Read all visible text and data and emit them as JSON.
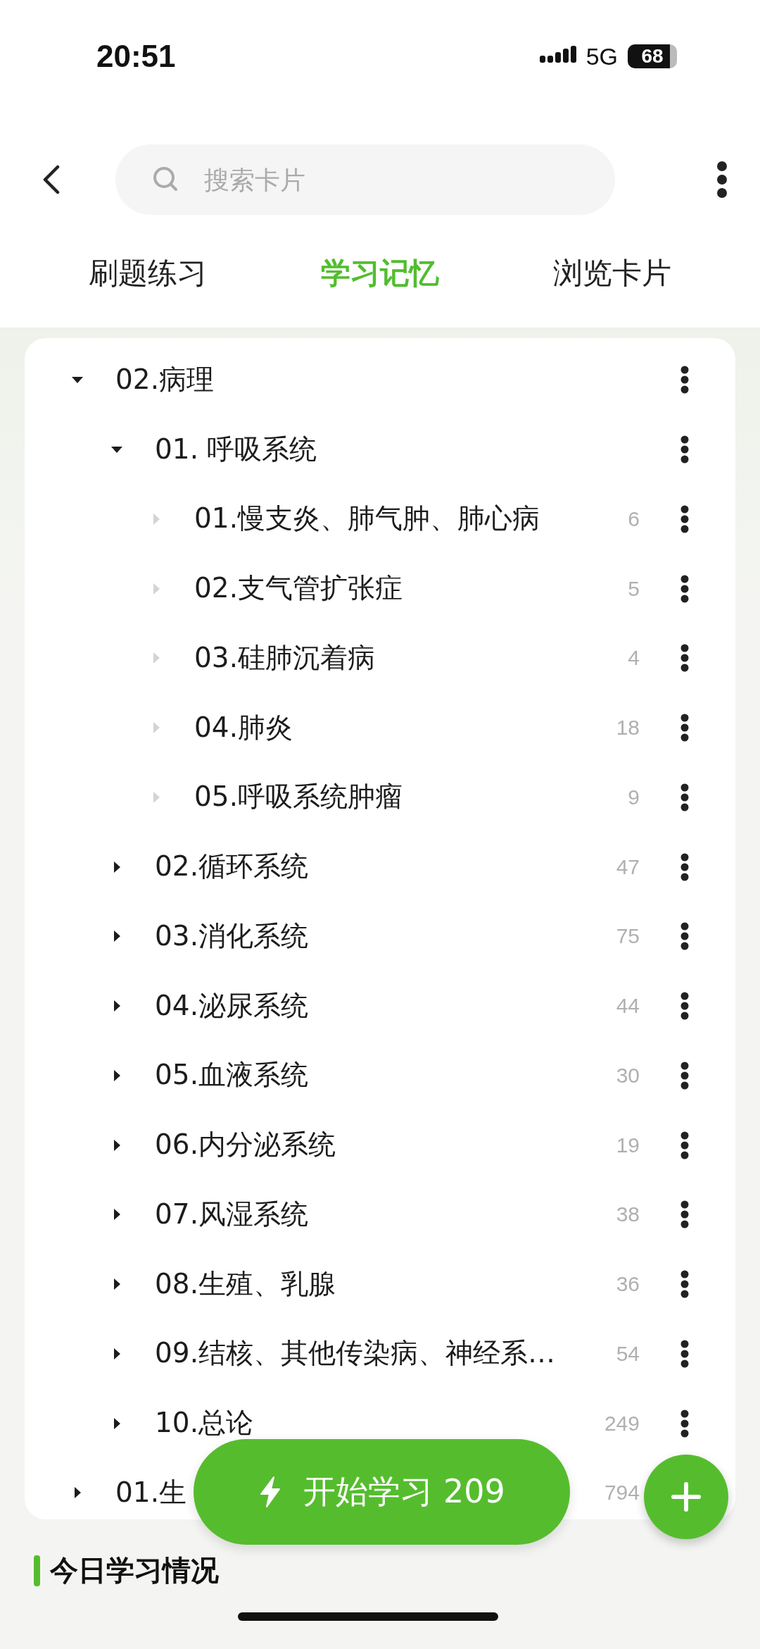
{
  "status_bar": {
    "time": "20:51",
    "network": "5G",
    "battery": "68"
  },
  "search": {
    "placeholder": "搜索卡片"
  },
  "tabs": [
    {
      "label": "刷题练习",
      "selected": false
    },
    {
      "label": "学习记忆",
      "selected": true
    },
    {
      "label": "浏览卡片",
      "selected": false
    }
  ],
  "tree": [
    {
      "kind": "folder",
      "label": "02.病理",
      "expanded": true,
      "children": [
        {
          "kind": "folder",
          "label": "01. 呼吸系统",
          "expanded": true,
          "children": [
            {
              "kind": "deck",
              "label": "01.慢支炎、肺气肿、肺心病",
              "count": "6",
              "expanded": false
            },
            {
              "kind": "deck",
              "label": "02.支气管扩张症",
              "count": "5",
              "expanded": false
            },
            {
              "kind": "deck",
              "label": "03.硅肺沉着病",
              "count": "4",
              "expanded": false
            },
            {
              "kind": "deck",
              "label": "04.肺炎",
              "count": "18",
              "expanded": false
            },
            {
              "kind": "deck",
              "label": "05.呼吸系统肿瘤",
              "count": "9",
              "expanded": false
            }
          ]
        },
        {
          "kind": "folder",
          "label": "02.循环系统",
          "count": "47",
          "expanded": false
        },
        {
          "kind": "folder",
          "label": "03.消化系统",
          "count": "75",
          "expanded": false
        },
        {
          "kind": "folder",
          "label": "04.泌尿系统",
          "count": "44",
          "expanded": false
        },
        {
          "kind": "folder",
          "label": "05.血液系统",
          "count": "30",
          "expanded": false
        },
        {
          "kind": "folder",
          "label": "06.内分泌系统",
          "count": "19",
          "expanded": false
        },
        {
          "kind": "folder",
          "label": "07.风湿系统",
          "count": "38",
          "expanded": false
        },
        {
          "kind": "folder",
          "label": "08.生殖、乳腺",
          "count": "36",
          "expanded": false
        },
        {
          "kind": "folder",
          "label": "09.结核、其他传染病、神经系…",
          "count": "54",
          "expanded": false
        },
        {
          "kind": "folder",
          "label": "10.总论",
          "count": "249",
          "expanded": false
        }
      ]
    },
    {
      "kind": "folder",
      "label": "01.生",
      "count": "794",
      "expanded": false
    }
  ],
  "start_button": {
    "label": "开始学习 209"
  },
  "section_title": "今日学习情况"
}
